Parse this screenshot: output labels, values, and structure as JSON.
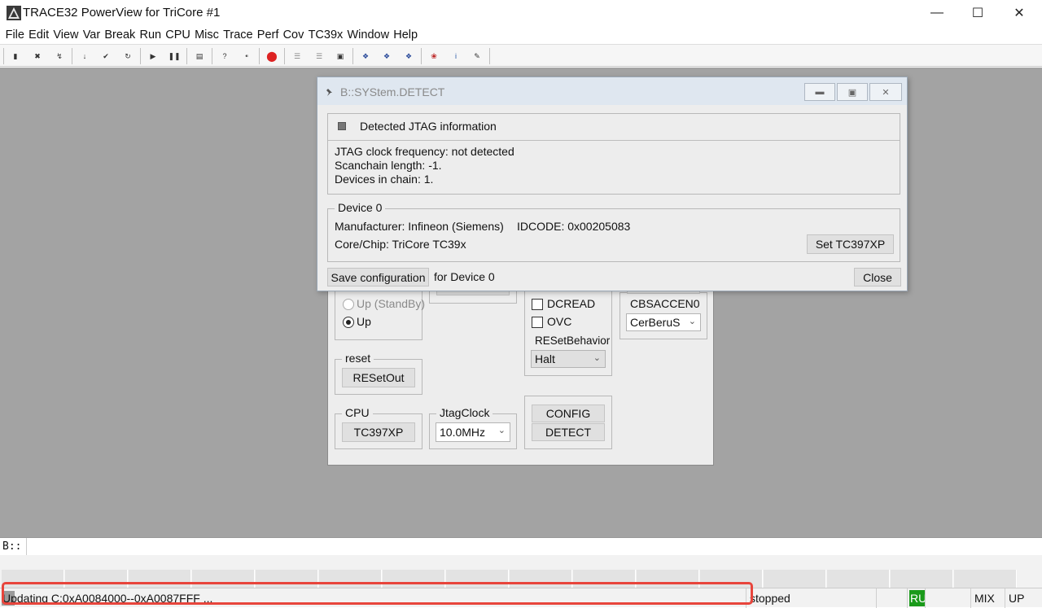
{
  "window": {
    "title": "TRACE32 PowerView for TriCore #1"
  },
  "menu": [
    "File",
    "Edit",
    "View",
    "Var",
    "Break",
    "Run",
    "CPU",
    "Misc",
    "Trace",
    "Perf",
    "Cov",
    "TC39x",
    "Window",
    "Help"
  ],
  "toolbar_icons": [
    "step-into-icon",
    "step-over-icon",
    "step-out-icon",
    "down-icon",
    "check-icon",
    "return-icon",
    "go-icon",
    "break-icon",
    "list-icon",
    "help-icon",
    "help-context-icon",
    "stop-icon",
    "list-source-icon",
    "list-mixed-icon",
    "memory-icon",
    "per-icon-1",
    "per-icon-2",
    "per-icon-3",
    "bug-icon",
    "info-icon",
    "tool-icon"
  ],
  "detect": {
    "title": "B::SYStem.DETECT",
    "jtag_header": "Detected JTAG information",
    "lines": [
      "JTAG clock frequency: not detected",
      "Scanchain length: -1.",
      "Devices in chain: 1."
    ],
    "device_group": "Device 0",
    "manufacturer": "Manufacturer: Infineon (Siemens)",
    "idcode": "IDCODE: 0x00205083",
    "core": "Core/Chip: TriCore TC39x",
    "set_button": "Set TC397XP",
    "save_button": "Save configuration",
    "for_device": "for Device 0",
    "close_button": "Close"
  },
  "system": {
    "mode_options": [
      "Up (StandBy)",
      "Up"
    ],
    "dcread": "DCREAD",
    "ovc": "OVC",
    "reset_behavior_label": "RESetBehavior",
    "reset_behavior_value": "Halt",
    "cbsaccen_label": "CBSACCEN0",
    "cbsaccen_value": "CerBeruS",
    "reset_group": "reset",
    "reset_out": "RESetOut",
    "cpu_group": "CPU",
    "cpu_button": "TC397XP",
    "jtagclock_label": "JtagClock",
    "jtagclock_value": "10.0MHz",
    "config_button": "CONFIG",
    "detect_button": "DETECT"
  },
  "cmd": {
    "prompt": "B::"
  },
  "status": {
    "message": "Updating C:0xA0084000--0xA0087FFF ...",
    "state": "stopped",
    "run": "RU",
    "mix": "MIX",
    "up": "UP",
    "run_color": "#1a9a1a",
    "highlight_color": "#e8453c"
  }
}
